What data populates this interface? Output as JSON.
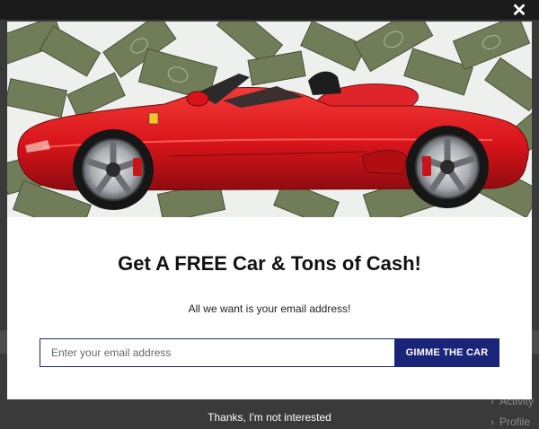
{
  "popup": {
    "headline": "Get A FREE Car & Tons of Cash!",
    "subline": "All we want is your email address!",
    "email_placeholder": "Enter your email address",
    "submit_label": "GIMME THE CAR",
    "decline_label": "Thanks, I'm not interested",
    "close_symbol": "✕"
  },
  "background_page": {
    "side_items": [
      "Activity",
      "Profile"
    ]
  },
  "icons": {
    "close": "close-icon",
    "chevron": "chevron-right-icon"
  },
  "colors": {
    "overlay": "#3a3a3a",
    "modal_bg": "#ffffff",
    "button_bg": "#1a2478",
    "input_border": "#1a2a6c",
    "car_red": "#d8141a",
    "cash_green": "#5e6b45"
  }
}
